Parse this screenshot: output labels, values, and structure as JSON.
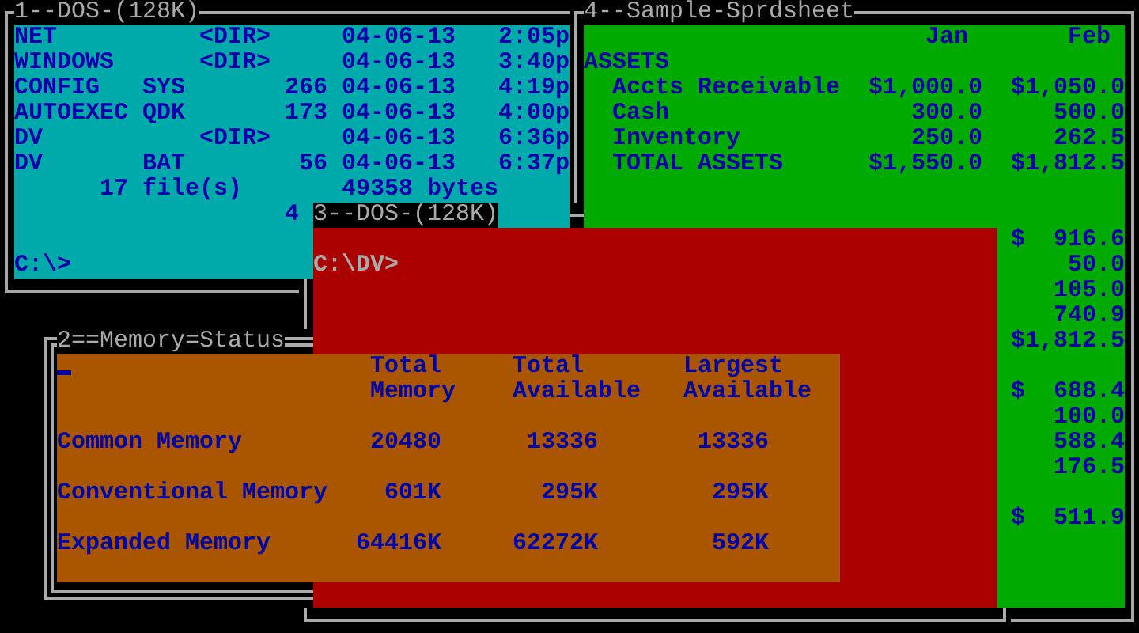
{
  "windows": [
    {
      "kind": "directory",
      "title": "1--DOS-(128K)",
      "color": "#00aaaa",
      "entries": [
        {
          "kind": "dir",
          "name": "NET",
          "size": "<DIR>",
          "date": "04-06-13",
          "time": "2:05p"
        },
        {
          "kind": "dir",
          "name": "WINDOWS",
          "size": "<DIR>",
          "date": "04-06-13",
          "time": "3:40p"
        },
        {
          "kind": "file",
          "name": "CONFIG",
          "ext": "SYS",
          "size": "266",
          "date": "04-06-13",
          "time": "4:19p"
        },
        {
          "kind": "file",
          "name": "AUTOEXEC",
          "ext": "QDK",
          "size": "173",
          "date": "04-06-13",
          "time": "4:00p"
        },
        {
          "kind": "dir",
          "name": "DV",
          "size": "<DIR>",
          "date": "04-06-13",
          "time": "6:36p"
        },
        {
          "kind": "file",
          "name": "DV",
          "ext": "BAT",
          "size": "56",
          "date": "04-06-13",
          "time": "6:37p"
        }
      ],
      "summary": {
        "files": "17 file(s)",
        "bytes": "49358 bytes"
      },
      "partial_line": "4",
      "prompt": "C:\\>"
    },
    {
      "kind": "spreadsheet",
      "title": "4--Sample-Sprdsheet",
      "color": "#00aa00",
      "columns": [
        "Jan",
        "Feb"
      ],
      "rows": [
        {
          "kind": "heading",
          "label": "ASSETS"
        },
        {
          "kind": "item",
          "label": "Accts Receivable",
          "jan": "$1,000.0",
          "feb": "$1,050.0"
        },
        {
          "kind": "item",
          "label": "Cash",
          "jan": "300.0",
          "feb": "500.0"
        },
        {
          "kind": "item",
          "label": "Inventory",
          "jan": "250.0",
          "feb": "262.5"
        },
        {
          "kind": "item",
          "label": "TOTAL ASSETS",
          "jan": "$1,550.0",
          "feb": "$1,812.5"
        },
        {
          "kind": "blank"
        },
        {
          "kind": "blank"
        },
        {
          "kind": "item",
          "feb": "$  916.6"
        },
        {
          "kind": "item",
          "feb": "50.0"
        },
        {
          "kind": "item",
          "feb": "105.0"
        },
        {
          "kind": "item",
          "feb": "740.9"
        },
        {
          "kind": "item",
          "feb": "$1,812.5"
        },
        {
          "kind": "blank"
        },
        {
          "kind": "item",
          "feb": "$  688.4"
        },
        {
          "kind": "item",
          "feb": "100.0"
        },
        {
          "kind": "item",
          "feb": "588.4"
        },
        {
          "kind": "item",
          "feb": "176.5"
        },
        {
          "kind": "blank"
        },
        {
          "kind": "item",
          "feb": "$  511.9"
        }
      ]
    },
    {
      "kind": "prompt",
      "title": "3--DOS-(128K)",
      "color": "#aa0000",
      "prompt": "C:\\DV>"
    },
    {
      "kind": "memory",
      "title": "2==Memory=Status",
      "color": "#aa5500",
      "cursor": true,
      "columns": [
        "Total Memory",
        "Total Available",
        "Largest Available"
      ],
      "rows": [
        {
          "label": "Common Memory",
          "values": [
            "20480",
            "13336",
            "13336"
          ]
        },
        {
          "label": "Conventional Memory",
          "values": [
            "601K",
            "295K",
            "295K"
          ]
        },
        {
          "label": "Expanded Memory",
          "values": [
            "64416K",
            "62272K",
            "592K"
          ]
        }
      ]
    }
  ]
}
